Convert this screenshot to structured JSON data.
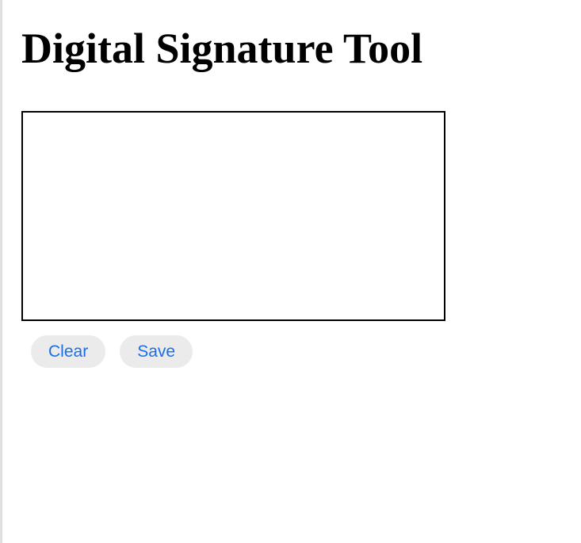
{
  "heading": "Digital Signature Tool",
  "buttons": {
    "clear": "Clear",
    "save": "Save"
  }
}
